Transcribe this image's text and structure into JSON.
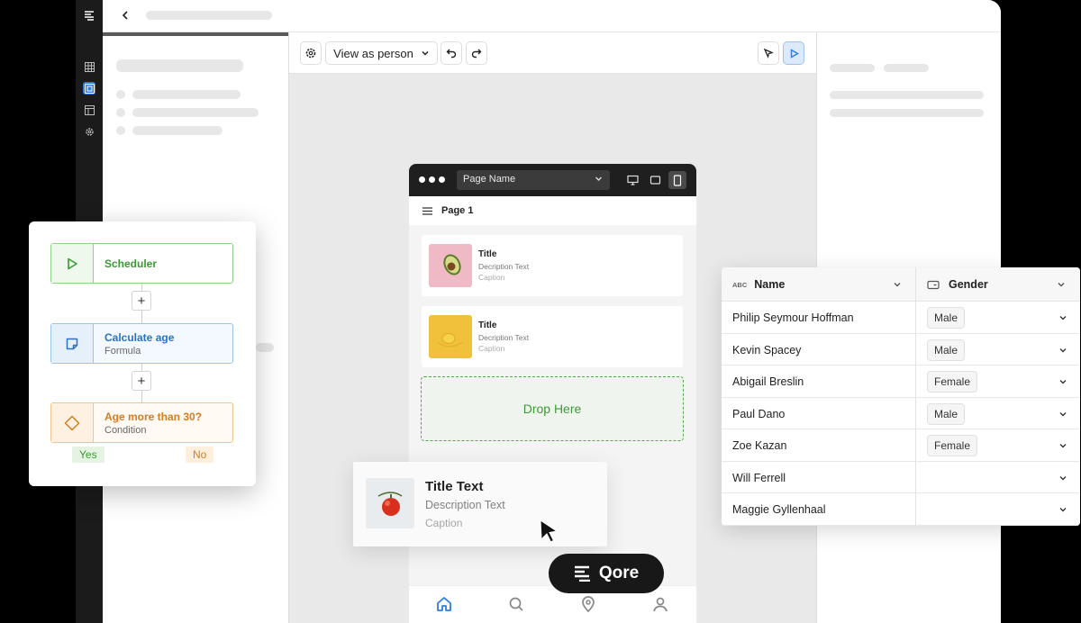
{
  "toolbar": {
    "view_as_label": "View as person"
  },
  "phone": {
    "page_select": "Page Name",
    "page_title": "Page 1",
    "cards": [
      {
        "title": "Title",
        "description": "Decription Text",
        "caption": "Caption"
      },
      {
        "title": "Title",
        "description": "Decription Text",
        "caption": "Caption"
      }
    ],
    "drop_label": "Drop Here"
  },
  "drag_card": {
    "title": "Title Text",
    "description": "Description Text",
    "caption": "Caption"
  },
  "brand": {
    "name": "Qore"
  },
  "workflow": {
    "nodes": [
      {
        "label": "Scheduler",
        "sub": ""
      },
      {
        "label": "Calculate age",
        "sub": "Formula"
      },
      {
        "label": "Age more than 30?",
        "sub": "Condition"
      }
    ],
    "yes_label": "Yes",
    "no_label": "No"
  },
  "table": {
    "columns": [
      {
        "type_badge": "ABC",
        "label": "Name"
      },
      {
        "label": "Gender"
      }
    ],
    "rows": [
      {
        "name": "Philip Seymour Hoffman",
        "gender": "Male"
      },
      {
        "name": "Kevin Spacey",
        "gender": "Male"
      },
      {
        "name": "Abigail Breslin",
        "gender": "Female"
      },
      {
        "name": "Paul Dano",
        "gender": "Male"
      },
      {
        "name": "Zoe Kazan",
        "gender": "Female"
      },
      {
        "name": "Will Ferrell",
        "gender": ""
      },
      {
        "name": "Maggie Gyllenhaal",
        "gender": ""
      }
    ]
  },
  "colors": {
    "accent": "#2f7de1",
    "success": "#3a9a32",
    "warning": "#d57d1e"
  }
}
